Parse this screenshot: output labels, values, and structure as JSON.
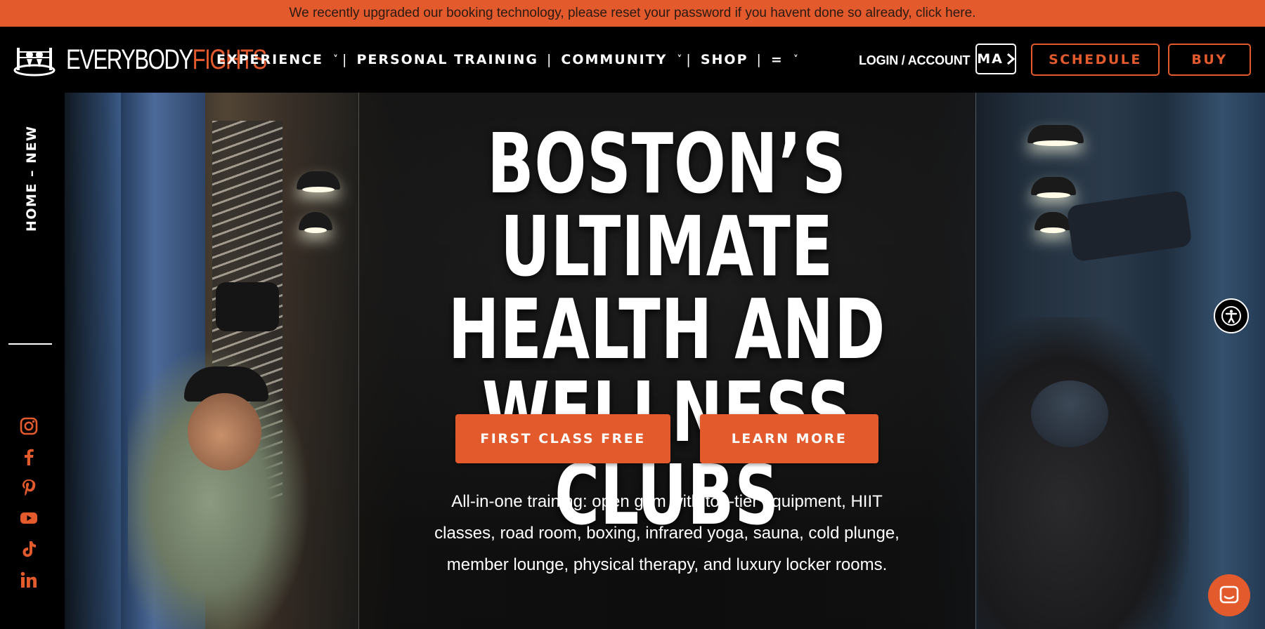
{
  "announcement": "We recently upgraded our booking technology, please reset your password if you havent done so already, click here.",
  "brand": {
    "part1": "EVERYBODY",
    "part2": "FIGHTS"
  },
  "nav": {
    "experience": "EXPERIENCE",
    "personal_training": "PERSONAL TRAINING",
    "community": "COMMUNITY",
    "shop": "SHOP",
    "menu_glyph": "=",
    "chevron": "˅",
    "separator": "|",
    "login": "LOGIN / ACCOUNT",
    "ma": "MA",
    "schedule": "SCHEDULE",
    "buy": "BUY"
  },
  "sidebar": {
    "page_label": "HOME – NEW",
    "social_icons": [
      "instagram-icon",
      "facebook-icon",
      "pinterest-icon",
      "youtube-icon",
      "tiktok-icon",
      "linkedin-icon"
    ]
  },
  "hero": {
    "headline": [
      "BOSTON’S ULTIMATE",
      "HEALTH AND",
      "WELLNESS CLUBS"
    ],
    "cta_primary": "FIRST CLASS FREE",
    "cta_secondary": "LEARN MORE",
    "description": "All-in-one training: open gym with top-tier equipment, HIIT classes, road room, boxing, infrared yoga, sauna, cold plunge, member lounge, physical therapy, and luxury locker rooms."
  },
  "colors": {
    "accent": "#e35a2c",
    "background": "#000000",
    "text": "#ffffff"
  }
}
